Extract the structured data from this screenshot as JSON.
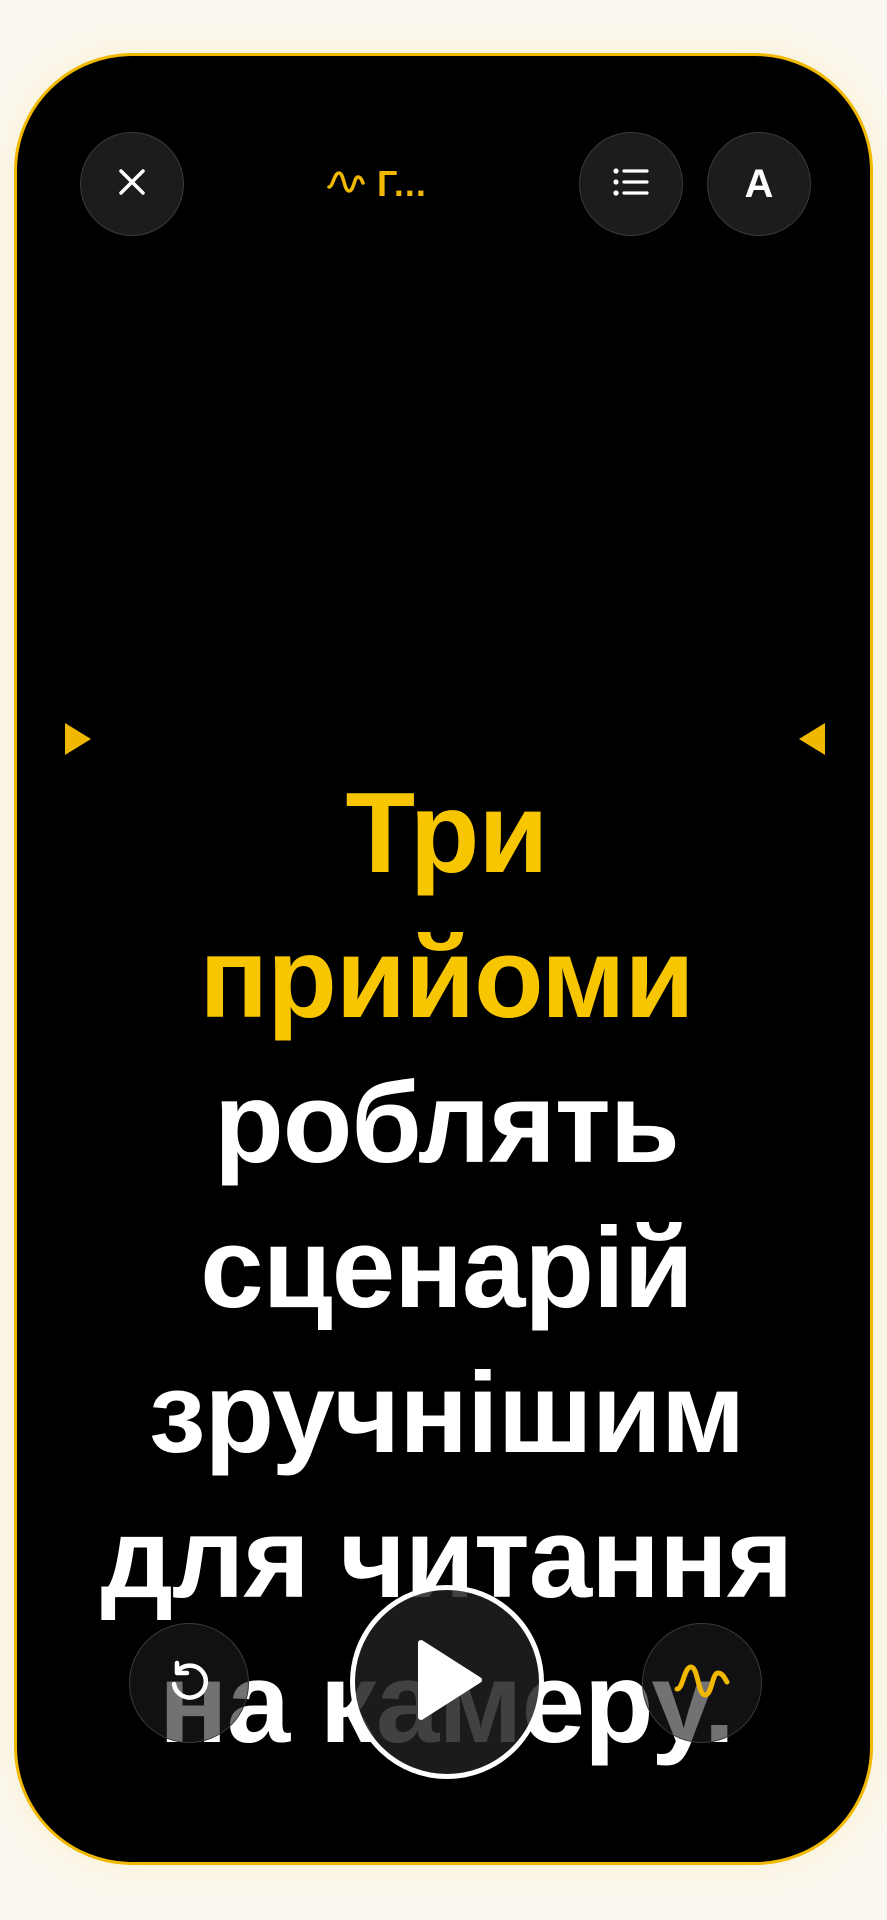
{
  "header": {
    "title": "Г...",
    "close_icon": "close-icon",
    "list_icon": "list-icon",
    "font_label": "A",
    "wave_icon": "waveform-icon"
  },
  "script": {
    "lines": [
      {
        "words": [
          {
            "text": "Три",
            "highlight": true
          }
        ]
      },
      {
        "words": [
          {
            "text": "прийоми",
            "highlight": true
          }
        ]
      },
      {
        "words": [
          {
            "text": "роблять",
            "highlight": false
          }
        ]
      },
      {
        "words": [
          {
            "text": "сценарій",
            "highlight": false
          }
        ]
      },
      {
        "words": [
          {
            "text": "зручнішим",
            "highlight": false
          }
        ]
      },
      {
        "words": [
          {
            "text": "для читання",
            "highlight": false
          }
        ]
      },
      {
        "words": [
          {
            "text": "на камеру.",
            "highlight": false
          }
        ]
      }
    ]
  },
  "controls": {
    "restart_icon": "restart-icon",
    "play_icon": "play-icon",
    "speed_icon": "waveform-icon"
  },
  "colors": {
    "accent": "#f7c600",
    "frame_border": "#f0b800",
    "background": "#000000",
    "button_bg": "#1c1c1e",
    "text": "#ffffff"
  }
}
